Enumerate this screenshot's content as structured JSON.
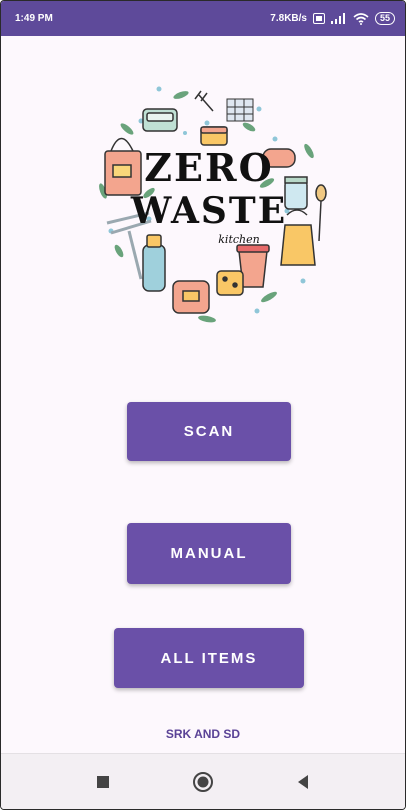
{
  "status_bar": {
    "time": "1:49 PM",
    "net_speed": "7.8KB/s",
    "battery": "55",
    "icons": [
      "volte-icon",
      "signal-icon",
      "wifi-icon",
      "battery-icon"
    ]
  },
  "logo": {
    "line1": "ZERO",
    "line2": "WASTE",
    "line3": "kitchen"
  },
  "buttons": {
    "scan": "SCAN",
    "manual": "MANUAL",
    "all_items": "ALL ITEMS"
  },
  "footer": {
    "credit": "SRK AND SD"
  },
  "nav": {
    "icons": [
      "recents-square-icon",
      "home-circle-icon",
      "back-triangle-icon"
    ]
  },
  "colors": {
    "status_bar": "#5e4a9a",
    "button": "#6a50a8",
    "background": "#fdf8fd",
    "footer_text": "#5a4296"
  }
}
